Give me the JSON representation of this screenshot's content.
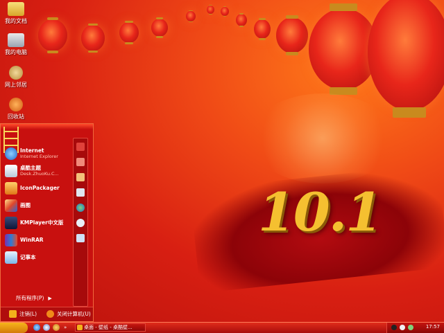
{
  "desktop": {
    "icons": [
      {
        "label": "我的文档",
        "icon": "my-documents-icon"
      },
      {
        "label": "我的电脑",
        "icon": "my-computer-icon"
      },
      {
        "label": "网上邻居",
        "icon": "network-places-icon"
      },
      {
        "label": "回收站",
        "icon": "recycle-bin-icon"
      }
    ],
    "wallpaper_text": "10.1"
  },
  "start_menu": {
    "programs": [
      {
        "name": "Internet",
        "sub": "Internet Explorer",
        "icon": "internet-explorer-icon"
      },
      {
        "name": "桌酷主题",
        "sub": "Desk.ZhuoKu.C...",
        "icon": "zhuoku-theme-icon"
      },
      {
        "name": "IconPackager",
        "sub": "",
        "icon": "iconpackager-icon"
      },
      {
        "name": "画图",
        "sub": "",
        "icon": "paint-icon"
      },
      {
        "name": "KMPlayer中文版",
        "sub": "",
        "icon": "kmplayer-icon"
      },
      {
        "name": "WinRAR",
        "sub": "",
        "icon": "winrar-icon"
      },
      {
        "name": "记事本",
        "sub": "",
        "icon": "notepad-icon"
      }
    ],
    "right_icons": [
      "my-documents-icon",
      "recent-icon",
      "my-pictures-icon",
      "control-panel-icon",
      "network-icon",
      "search-icon",
      "run-icon"
    ],
    "all_programs": "所有程序(P)",
    "logoff": "注销(L)",
    "shutdown": "关闭计算机(U)"
  },
  "taskbar": {
    "task_label": "桌面 - 壁纸 - 桌酷壁...",
    "clock": "17:57"
  },
  "colors": {
    "accent": "#c8100f",
    "gold": "#f3b21b"
  }
}
